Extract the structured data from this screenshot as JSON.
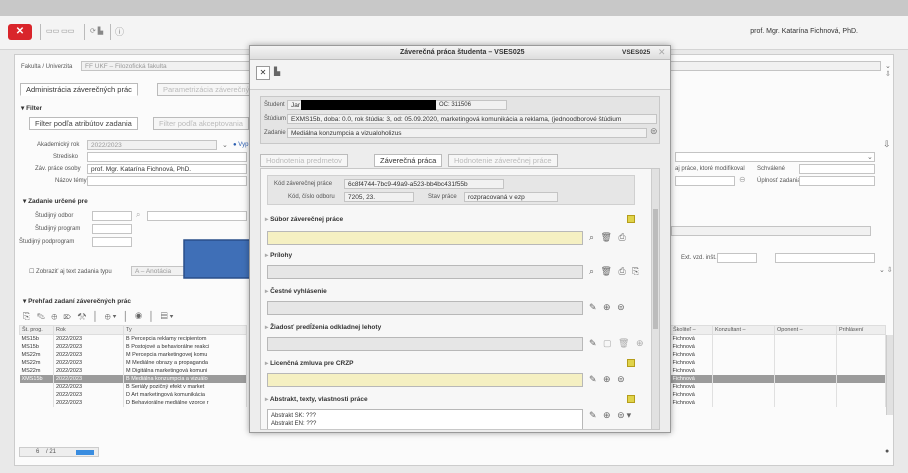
{
  "toolbar": {
    "close_label": "✕",
    "user_name": "prof. Mgr. Katarína Fichnová, PhD."
  },
  "breadcrumb": {
    "label": "Fakulta / Univerzita",
    "value": "FF UKF – Filozofická fakulta"
  },
  "tabs": {
    "main": "Administrácia záverečných prác",
    "params": "Parametrizácia záverečných prác"
  },
  "filter": {
    "title": "Filter",
    "tab_attr": "Filter podľa atribútov zadania",
    "tab_accept": "Filter podľa akceptovania",
    "year_label": "Akademický rok",
    "year_value": "2022/2023",
    "center_label": "Stredisko",
    "author_label": "Záv. práce osoby",
    "author_value": "prof. Mgr. Katarína Fichnová, PhD.",
    "topic_label": "Názov témy",
    "radio_label": "Vyp",
    "right_label1": "aj práce, ktoré modifikoval",
    "right_label2": "Schválené",
    "right_label3": "Úplnosť zadania",
    "designated_title": "Zadanie určené pre",
    "field_label": "Študijný odbor",
    "program_label": "Študijný program",
    "subprogram_label": "Študijný podprogram",
    "ext_label": "Ext. vzd. inšt.",
    "show_text_label": "Zobraziť aj text zadania typu",
    "show_text_value": "A – Anotácia"
  },
  "overview": {
    "title": "Prehľad zadaní záverečných prác",
    "columns": [
      "Št. prog.",
      "Rok",
      "Ty"
    ],
    "right_columns": [
      "Školiteľ –",
      "Konzultant –",
      "Oponent –",
      "Prihlásení"
    ],
    "rows": [
      {
        "prog": "MS15b",
        "year": "2022/2023",
        "type": "B",
        "title": "Percepcia reklamy recipientom",
        "sup": "Fichnová"
      },
      {
        "prog": "MS15b",
        "year": "2022/2023",
        "type": "B",
        "title": "Postojové a behaviorálne reakci",
        "sup": "Fichnová"
      },
      {
        "prog": "MS22m",
        "year": "2022/2023",
        "type": "M",
        "title": "Percepcia marketingovej komu",
        "sup": "Fichnová"
      },
      {
        "prog": "MS22m",
        "year": "2022/2023",
        "type": "M",
        "title": "Mediálne obrazy a propaganda",
        "sup": "Fichnová"
      },
      {
        "prog": "MS22m",
        "year": "2022/2023",
        "type": "M",
        "title": "Digitálna marketingová komuni",
        "sup": "Fichnová"
      },
      {
        "prog": "XMS15b",
        "year": "2022/2023",
        "type": "B",
        "title": "Mediálna konzumpcia a vizuálo",
        "sup": "Fichnová"
      },
      {
        "prog": "",
        "year": "2022/2023",
        "type": "B",
        "title": "Seriály pozičný efekt v market",
        "sup": "Fichnová"
      },
      {
        "prog": "",
        "year": "2022/2023",
        "type": "D",
        "title": "Art marketingová komunikácia",
        "sup": "Fichnová"
      },
      {
        "prog": "",
        "year": "2022/2023",
        "type": "D",
        "title": "Behaviorálne mediálne vzorce r",
        "sup": "Fichnová"
      }
    ],
    "pager_current": "6",
    "pager_total": "/ 21"
  },
  "dialog": {
    "title": "Záverečná práca študenta – VSES025",
    "code": "VSES025",
    "student_label": "Študent",
    "student_value_start": "Jar",
    "student_value_end": "OC: 311506",
    "study_label": "Štúdium",
    "study_value": "EXMS15b, doba: 0.0, rok štúdia: 3, od: 05.09.2020, marketingová komunikácia a reklama, (jednoodborové štúdium",
    "assign_label": "Zadanie",
    "assign_value": "Mediálna konzumpcia a vizualoholizus",
    "tabs": [
      "Hodnotenia predmetov",
      "Záverečná práca",
      "Hodnotenie záverečnej práce"
    ],
    "code_label": "Kód záverečnej práce",
    "code_value": "6c8f4744-7bc9-49a9-a523-bb4bc431f55b",
    "field_code_label": "Kód, číslo odboru",
    "field_code_value": "7205, 23.",
    "state_label": "Stav práce",
    "state_value": "rozpracovaná v ezp",
    "sections": [
      "Súbor záverečnej práce",
      "Prílohy",
      "Čestné vyhlásenie",
      "Žiadosť predĺženia odkladnej lehoty",
      "Licenčná zmluva pre CRZP",
      "Abstrakt, texty, vlastnosti práce"
    ],
    "abstract_sk": "Abstrakt SK: ???",
    "abstract_en": "Abstrakt EN: ???"
  },
  "colors": {
    "accent": "#d9252b",
    "arrow": "#3f6fb7"
  }
}
